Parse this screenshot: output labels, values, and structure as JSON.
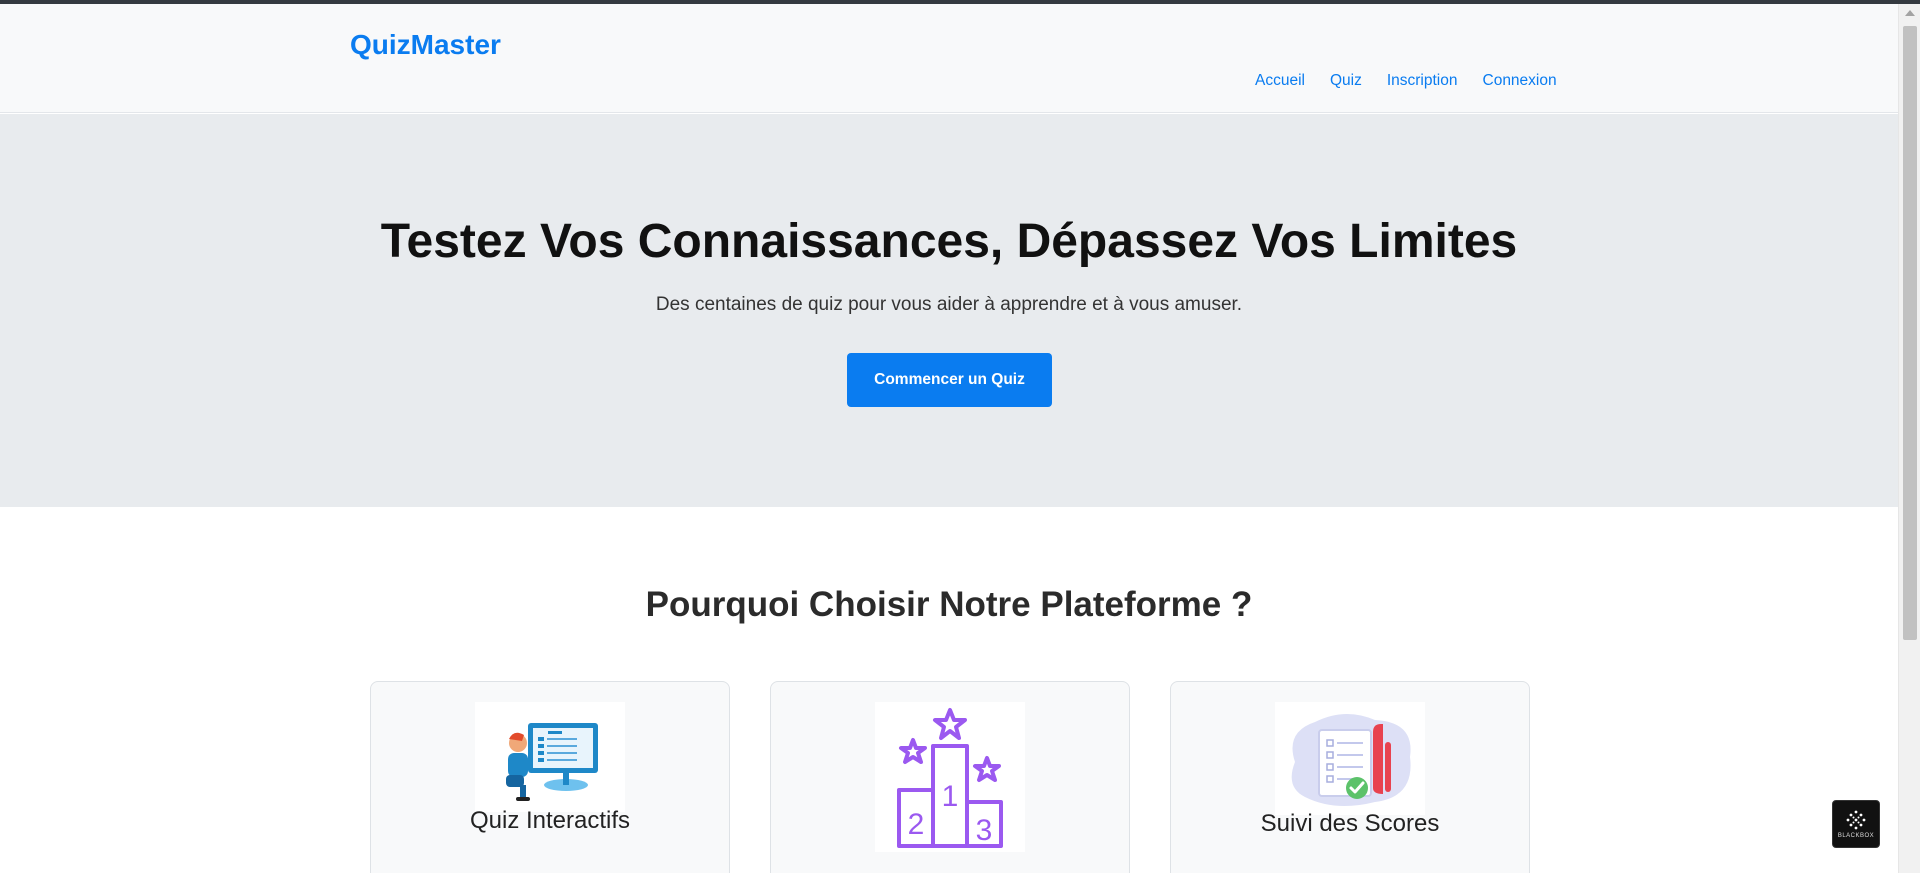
{
  "header": {
    "logo": "QuizMaster",
    "nav": [
      "Accueil",
      "Quiz",
      "Inscription",
      "Connexion"
    ]
  },
  "hero": {
    "title": "Testez Vos Connaissances, Dépassez Vos Limites",
    "subtitle": "Des centaines de quiz pour vous aider à apprendre et à vous amuser.",
    "cta": "Commencer un Quiz"
  },
  "features": {
    "title": "Pourquoi Choisir Notre Plateforme ?",
    "cards": [
      {
        "title": "Quiz Interactifs",
        "icon": "computer-user-illustration-icon"
      },
      {
        "title": "",
        "icon": "podium-stars-icon"
      },
      {
        "title": "Suivi des Scores",
        "icon": "clipboard-checklist-illustration-icon"
      }
    ]
  },
  "widget": {
    "label": "BLACKBOX",
    "icon": "blackbox-logo-icon"
  },
  "colors": {
    "accent": "#0a7cf0",
    "hero_bg": "#e8ebee",
    "header_bg": "#f8f9fa",
    "podium": "#9b59f0"
  }
}
